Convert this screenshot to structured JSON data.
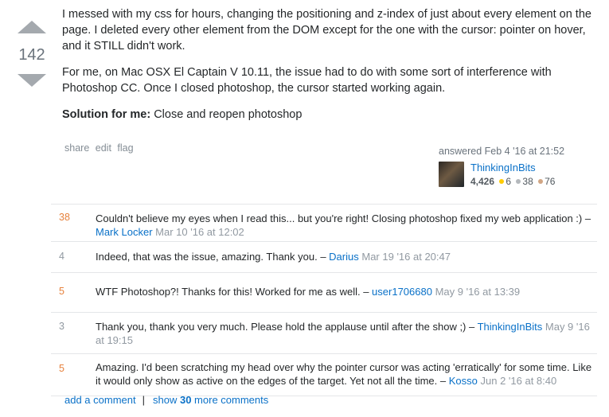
{
  "vote": {
    "score": "142"
  },
  "post": {
    "paragraph1": "I messed with my css for hours, changing the positioning and z-index of just about every element on the page. I deleted every other element from the DOM except for the one with the cursor: pointer on hover, and it STILL didn't work.",
    "paragraph2": "For me, on Mac OSX El Captain V 10.11, the issue had to do with some sort of interference with Photoshop CC. Once I closed photoshop, the cursor started working again.",
    "solution_label": "Solution for me:",
    "solution_text": " Close and reopen photoshop"
  },
  "actions": {
    "share": "share",
    "edit": "edit",
    "flag": "flag"
  },
  "signature": {
    "answered": "answered Feb 4 '16 at 21:52",
    "user": "ThinkingInBits",
    "reputation": "4,426",
    "gold": "6",
    "silver": "38",
    "bronze": "76"
  },
  "comments": [
    {
      "score": "38",
      "text": "Couldn't believe my eyes when I read this... but you're right! Closing photoshop fixed my web application :) – ",
      "user": "Mark Locker",
      "date": "Mar 10 '16 at 12:02"
    },
    {
      "score": "4",
      "text": "Indeed, that was the issue, amazing. Thank you. – ",
      "user": "Darius",
      "date": "Mar 19 '16 at 20:47"
    },
    {
      "score": "5",
      "text": "WTF Photoshop?! Thanks for this! Worked for me as well. – ",
      "user": "user1706680",
      "date": "May 9 '16 at 13:39"
    },
    {
      "score": "3",
      "text": "Thank you, thank you very much. Please hold the applause until after the show ;) – ",
      "user": "ThinkingInBits",
      "date": "May 9 '16 at 19:15"
    },
    {
      "score": "5",
      "text": "Amazing. I'd been scratching my head over why the pointer cursor was acting 'erratically' for some time. Like it would only show as active on the edges of the target. Yet not all the time. – ",
      "user": "Kosso",
      "date": "Jun 2 '16 at 8:40"
    }
  ],
  "footer": {
    "add_comment": "add a comment",
    "separator": "|",
    "show_prefix": "show ",
    "show_count": "30",
    "show_suffix": " more comments"
  },
  "colors": {
    "link": "#0a71c8",
    "hot_score": "#e6813c",
    "muted": "#9199a1"
  }
}
